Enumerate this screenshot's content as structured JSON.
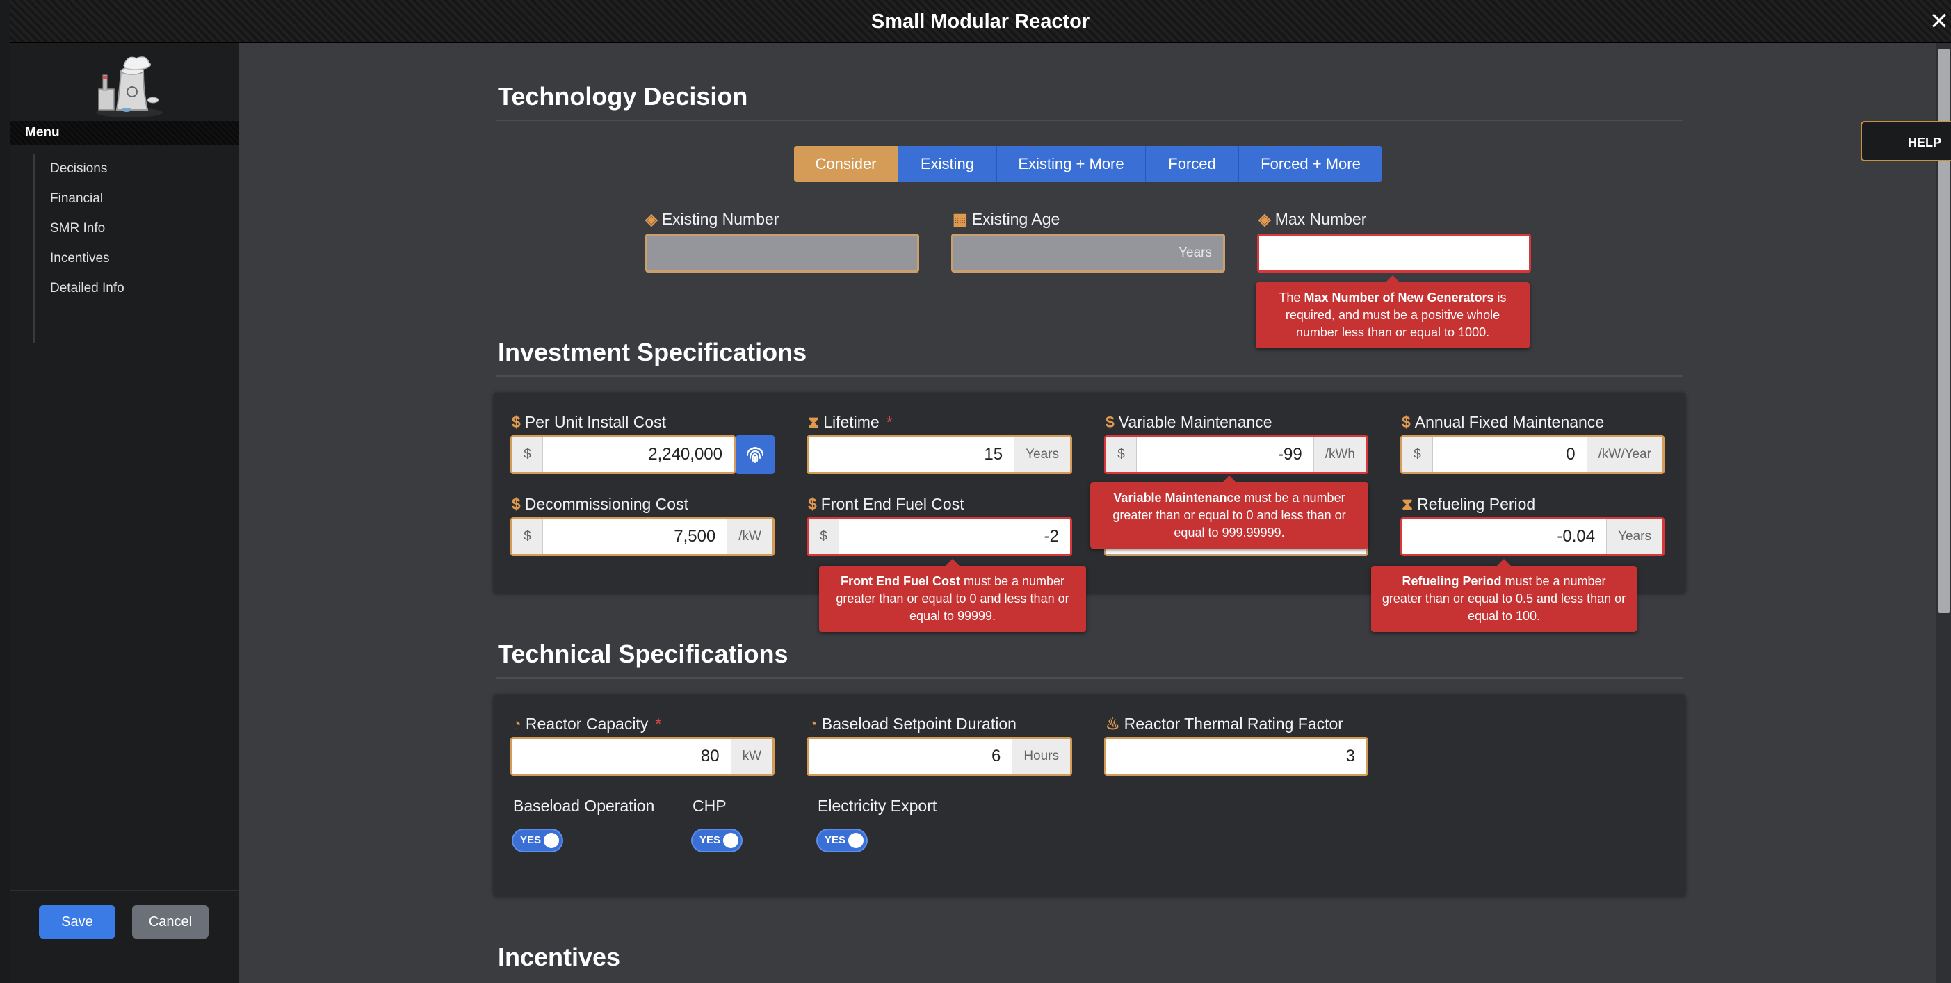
{
  "window": {
    "title": "Small Modular Reactor",
    "close_glyph": "✕"
  },
  "sidebar": {
    "menu_title": "Menu",
    "items": [
      {
        "label": "Decisions"
      },
      {
        "label": "Financial"
      },
      {
        "label": "SMR Info"
      },
      {
        "label": "Incentives"
      },
      {
        "label": "Detailed Info"
      }
    ],
    "save_label": "Save",
    "cancel_label": "Cancel"
  },
  "help": {
    "label": "HELP"
  },
  "technology_decision": {
    "title": "Technology Decision",
    "options": [
      "Consider",
      "Existing",
      "Existing + More",
      "Forced",
      "Forced + More"
    ],
    "selected": "Consider",
    "existing_number": {
      "label": "Existing Number",
      "value": ""
    },
    "existing_age": {
      "label": "Existing Age",
      "value": "",
      "unit": "Years"
    },
    "max_number": {
      "label": "Max Number",
      "value": "",
      "error_bold": "Max Number of New Generators",
      "error_pre": "The ",
      "error_post": " is required, and must be a positive whole number less than or equal to 1000."
    }
  },
  "investment": {
    "title": "Investment Specifications",
    "per_unit_install_cost": {
      "label": "Per Unit Install Cost",
      "prefix": "$",
      "value": "2,240,000"
    },
    "lifetime": {
      "label": "Lifetime",
      "required_mark": "*",
      "value": "15",
      "unit": "Years"
    },
    "variable_maintenance": {
      "label": "Variable Maintenance",
      "prefix": "$",
      "value": "-99",
      "unit": "/kWh",
      "error_bold": "Variable Maintenance",
      "error_post": " must be a number greater than or equal to 0 and less than or equal to 999.99999."
    },
    "annual_fixed_maintenance": {
      "label": "Annual Fixed Maintenance",
      "prefix": "$",
      "value": "0",
      "unit": "/kW/Year"
    },
    "decommissioning_cost": {
      "label": "Decommissioning Cost",
      "prefix": "$",
      "value": "7,500",
      "unit": "/kW"
    },
    "front_end_fuel_cost": {
      "label": "Front End Fuel Cost",
      "prefix": "$",
      "value": "-2",
      "error_bold": "Front End Fuel Cost",
      "error_post": " must be a number greater than or equal to 0 and less than or equal to 99999."
    },
    "refueling_period": {
      "label": "Refueling Period",
      "value": "-0.04",
      "unit": "Years",
      "error_bold": "Refueling Period",
      "error_post": " must be a number greater than or equal to 0.5 and less than or equal to 100."
    }
  },
  "technical": {
    "title": "Technical Specifications",
    "reactor_capacity": {
      "label": "Reactor Capacity",
      "required_mark": "*",
      "value": "80",
      "unit": "kW"
    },
    "baseload_setpoint_duration": {
      "label": "Baseload Setpoint Duration",
      "value": "6",
      "unit": "Hours"
    },
    "reactor_thermal_rating_factor": {
      "label": "Reactor Thermal Rating Factor",
      "value": "3"
    },
    "toggles": [
      {
        "label": "Baseload Operation",
        "state": "YES"
      },
      {
        "label": "CHP",
        "state": "YES"
      },
      {
        "label": "Electricity Export",
        "state": "YES"
      }
    ]
  },
  "incentives": {
    "title": "Incentives"
  },
  "colors": {
    "accent_orange": "#d59c58",
    "primary_blue": "#3a6fd6",
    "error_red": "#c73232",
    "panel_bg": "#2c2d30",
    "main_bg": "#3b3c40"
  }
}
